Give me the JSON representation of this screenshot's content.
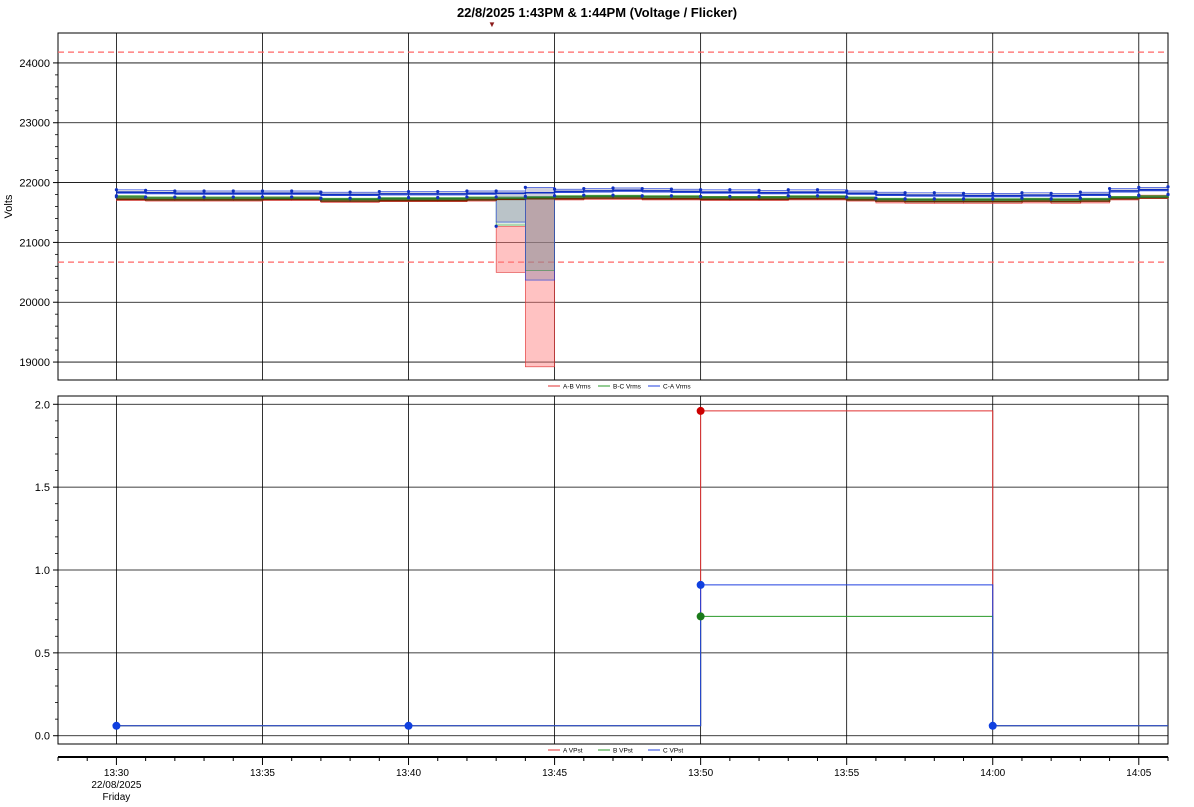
{
  "title": "22/8/2025 1:43PM & 1:44PM (Voltage / Flicker)",
  "colors": {
    "a": "#e03030",
    "b": "#2a9a2a",
    "c": "#2040e0",
    "limit": "#ff6666",
    "grid": "#000000",
    "background": "#ffffff"
  },
  "x_axis": {
    "range_minutes": [
      "13:28",
      "14:06"
    ],
    "ticks": [
      "13:30",
      "13:35",
      "13:40",
      "13:45",
      "13:50",
      "13:55",
      "14:00",
      "14:05"
    ],
    "date_label": "22/08/2025",
    "day_label": "Friday"
  },
  "chart_data": [
    {
      "type": "line",
      "title": "22/8/2025 1:43PM & 1:44PM (Voltage / Flicker)",
      "ylabel": "Volts",
      "ylim": [
        18700,
        24500
      ],
      "yticks": [
        19000,
        20000,
        21000,
        22000,
        23000,
        24000
      ],
      "grid": true,
      "limit_lines": [
        24180,
        20670
      ],
      "legend_position": "bottom-center",
      "x": [
        "13:30",
        "13:31",
        "13:32",
        "13:33",
        "13:34",
        "13:35",
        "13:36",
        "13:37",
        "13:38",
        "13:39",
        "13:40",
        "13:41",
        "13:42",
        "13:43",
        "13:44",
        "13:45",
        "13:46",
        "13:47",
        "13:48",
        "13:49",
        "13:50",
        "13:51",
        "13:52",
        "13:53",
        "13:54",
        "13:55",
        "13:56",
        "13:57",
        "13:58",
        "13:59",
        "14:00",
        "14:01",
        "14:02",
        "14:03",
        "14:04",
        "14:05",
        "14:06"
      ],
      "series": [
        {
          "name": "A-B Vrms",
          "avg": [
            21720,
            21710,
            21710,
            21710,
            21710,
            21720,
            21720,
            21690,
            21690,
            21700,
            21700,
            21700,
            21710,
            21720,
            21730,
            21730,
            21740,
            21740,
            21730,
            21730,
            21720,
            21720,
            21720,
            21730,
            21730,
            21710,
            21690,
            21680,
            21680,
            21680,
            21680,
            21690,
            21680,
            21690,
            21730,
            21750,
            21760
          ],
          "min": [
            21700,
            21690,
            21690,
            21690,
            21690,
            21700,
            21700,
            21670,
            21670,
            21680,
            21680,
            21680,
            21690,
            20500,
            18920,
            21710,
            21720,
            21720,
            21710,
            21710,
            21700,
            21700,
            21700,
            21710,
            21710,
            21690,
            21660,
            21650,
            21650,
            21650,
            21650,
            21660,
            21650,
            21660,
            21710,
            21730,
            21740
          ],
          "max": [
            21760,
            21750,
            21750,
            21750,
            21750,
            21760,
            21760,
            21730,
            21730,
            21740,
            21740,
            21740,
            21750,
            21270,
            21740,
            21770,
            21780,
            21780,
            21770,
            21770,
            21760,
            21760,
            21760,
            21770,
            21770,
            21750,
            21730,
            21720,
            21720,
            21720,
            21720,
            21730,
            21720,
            21730,
            21770,
            21790,
            21800
          ]
        },
        {
          "name": "B-C Vrms",
          "avg": [
            21760,
            21740,
            21740,
            21740,
            21740,
            21740,
            21740,
            21720,
            21720,
            21730,
            21730,
            21730,
            21740,
            21740,
            21750,
            21760,
            21770,
            21770,
            21760,
            21760,
            21750,
            21750,
            21750,
            21760,
            21760,
            21740,
            21720,
            21710,
            21710,
            21710,
            21710,
            21720,
            21710,
            21720,
            21750,
            21760,
            21780
          ],
          "min": [
            21740,
            21720,
            21720,
            21720,
            21720,
            21720,
            21720,
            21700,
            21700,
            21710,
            21710,
            21710,
            21720,
            21290,
            20530,
            21740,
            21750,
            21750,
            21740,
            21740,
            21730,
            21730,
            21730,
            21740,
            21740,
            21720,
            21700,
            21690,
            21690,
            21690,
            21690,
            21700,
            21690,
            21700,
            21730,
            21740,
            21760
          ],
          "max": [
            21780,
            21760,
            21760,
            21760,
            21760,
            21760,
            21760,
            21740,
            21740,
            21750,
            21750,
            21750,
            21760,
            21760,
            21770,
            21780,
            21790,
            21790,
            21780,
            21780,
            21770,
            21770,
            21770,
            21780,
            21780,
            21760,
            21740,
            21730,
            21730,
            21730,
            21730,
            21740,
            21730,
            21740,
            21770,
            21780,
            21800
          ]
        },
        {
          "name": "C-A Vrms",
          "avg": [
            21840,
            21830,
            21820,
            21820,
            21820,
            21820,
            21820,
            21800,
            21800,
            21810,
            21810,
            21810,
            21820,
            21820,
            21830,
            21850,
            21860,
            21870,
            21860,
            21850,
            21840,
            21840,
            21830,
            21840,
            21840,
            21820,
            21800,
            21790,
            21790,
            21780,
            21780,
            21790,
            21780,
            21800,
            21860,
            21880,
            21890
          ],
          "min": [
            21820,
            21810,
            21800,
            21800,
            21800,
            21800,
            21800,
            21780,
            21780,
            21790,
            21790,
            21790,
            21800,
            21340,
            20370,
            21830,
            21840,
            21850,
            21840,
            21830,
            21820,
            21820,
            21810,
            21820,
            21820,
            21800,
            21780,
            21770,
            21770,
            21760,
            21760,
            21770,
            21760,
            21780,
            21840,
            21860,
            21870
          ],
          "max": [
            21880,
            21870,
            21860,
            21860,
            21860,
            21860,
            21860,
            21840,
            21840,
            21850,
            21850,
            21850,
            21860,
            21860,
            21920,
            21890,
            21900,
            21910,
            21900,
            21890,
            21880,
            21880,
            21870,
            21880,
            21880,
            21860,
            21840,
            21830,
            21830,
            21820,
            21820,
            21830,
            21820,
            21840,
            21900,
            21920,
            21930
          ]
        }
      ]
    },
    {
      "type": "line",
      "ylabel": "",
      "ylim": [
        -0.05,
        2.05
      ],
      "yticks": [
        0.0,
        0.5,
        1.0,
        1.5,
        2.0
      ],
      "grid": true,
      "legend_position": "bottom-center",
      "x": [
        "13:30",
        "13:40",
        "13:50",
        "14:00"
      ],
      "series": [
        {
          "name": "A VPst",
          "values": [
            0.06,
            0.06,
            1.96,
            0.06
          ]
        },
        {
          "name": "B VPst",
          "values": [
            0.06,
            0.06,
            0.72,
            0.06
          ]
        },
        {
          "name": "C VPst",
          "values": [
            0.06,
            0.06,
            0.91,
            0.06
          ]
        }
      ]
    }
  ]
}
